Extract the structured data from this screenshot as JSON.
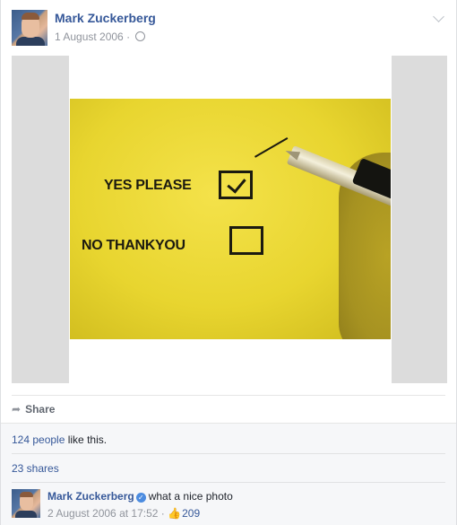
{
  "post": {
    "author": "Mark Zuckerberg",
    "date": "1 August 2006",
    "separator": "·",
    "privacy_icon": "globe-icon",
    "menu_icon": "chevron-down-icon"
  },
  "photo": {
    "text_yes": "YES PLEASE",
    "text_no": "NO THANKYOU"
  },
  "actions": {
    "share_label": "Share",
    "share_icon": "share-arrow-icon"
  },
  "likes": {
    "people_link": "124 people",
    "suffix": " like this."
  },
  "shares": {
    "label": "23 shares"
  },
  "comment": {
    "author": "Mark Zuckerberg",
    "verified_icon": "verified-badge-icon",
    "text": "what a nice photo",
    "timestamp": "2 August 2006 at 17:52",
    "separator": "·",
    "like_count": "209",
    "like_icon": "thumbs-up-icon"
  },
  "colors": {
    "link": "#365899",
    "meta": "#90949c",
    "footer_bg": "#f6f7f9",
    "photo_bg": "#dcdcdc"
  }
}
